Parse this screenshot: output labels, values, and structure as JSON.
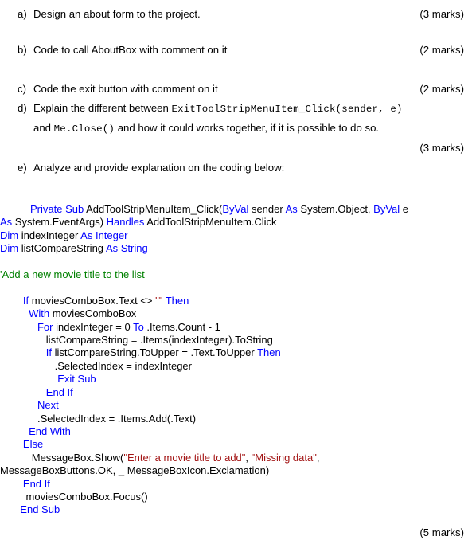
{
  "document": {
    "type": "exam-question-sheet",
    "questions": [
      {
        "marker": "a)",
        "text": "Design an about form to the project.",
        "marks": "(3 marks)"
      },
      {
        "marker": "b)",
        "text": "Code to call AboutBox with comment on it",
        "marks": "(2 marks)"
      },
      {
        "marker": "c)",
        "text": "Code the exit button with comment on it",
        "marks": "(2 marks)"
      },
      {
        "marker": "d)",
        "line1_prefix": "Explain the different between ",
        "line1_code": "ExitToolStripMenuItem_Click(sender, e)",
        "line2_prefix": "and ",
        "line2_code": "Me.Close()",
        "line2_suffix": "  and how it could works together, if it is possible to do so.",
        "marks": "(3 marks)"
      },
      {
        "marker": "e)",
        "text": "Analyze and provide explanation on the coding below:",
        "marks": "(5 marks)"
      }
    ]
  },
  "code_listing": {
    "language": "VB.NET",
    "colors": {
      "keyword": "#0000ff",
      "string": "#a31515",
      "comment": "#008000",
      "plain": "#000000"
    },
    "lines": [
      {
        "flush": false,
        "tokens": [
          {
            "t": "Private Sub ",
            "c": "kw"
          },
          {
            "t": "AddToolStripMenuItem_Click(",
            "c": "pln"
          },
          {
            "t": "ByVal ",
            "c": "kw"
          },
          {
            "t": "sender ",
            "c": "pln"
          },
          {
            "t": "As ",
            "c": "kw"
          },
          {
            "t": "System.Object, ",
            "c": "pln"
          },
          {
            "t": "ByVal ",
            "c": "kw"
          },
          {
            "t": "e",
            "c": "pln"
          }
        ]
      },
      {
        "flush": true,
        "tokens": [
          {
            "t": "As ",
            "c": "kw"
          },
          {
            "t": "System.EventArgs) ",
            "c": "pln"
          },
          {
            "t": "Handles ",
            "c": "kw"
          },
          {
            "t": "AddToolStripMenuItem.Click",
            "c": "pln"
          }
        ]
      },
      {
        "flush": true,
        "tokens": [
          {
            "t": "Dim ",
            "c": "kw"
          },
          {
            "t": "indexInteger ",
            "c": "pln"
          },
          {
            "t": "As Integer",
            "c": "kw"
          }
        ]
      },
      {
        "flush": true,
        "tokens": [
          {
            "t": "Dim ",
            "c": "kw"
          },
          {
            "t": "listCompareString ",
            "c": "pln"
          },
          {
            "t": "As String",
            "c": "kw"
          }
        ]
      },
      {
        "flush": true,
        "tokens": [
          {
            "t": "",
            "c": "pln"
          }
        ]
      },
      {
        "flush": true,
        "tokens": [
          {
            "t": "'Add a new movie title to the list",
            "c": "cmt"
          }
        ]
      },
      {
        "flush": true,
        "tokens": [
          {
            "t": "",
            "c": "pln"
          }
        ]
      },
      {
        "flush": true,
        "tokens": [
          {
            "t": "        ",
            "c": "pln"
          },
          {
            "t": "If ",
            "c": "kw"
          },
          {
            "t": "moviesComboBox.Text <> ",
            "c": "pln"
          },
          {
            "t": "\"\"",
            "c": "str"
          },
          {
            "t": " ",
            "c": "pln"
          },
          {
            "t": "Then",
            "c": "kw"
          }
        ]
      },
      {
        "flush": true,
        "tokens": [
          {
            "t": "          ",
            "c": "pln"
          },
          {
            "t": "With ",
            "c": "kw"
          },
          {
            "t": "moviesComboBox",
            "c": "pln"
          }
        ]
      },
      {
        "flush": true,
        "tokens": [
          {
            "t": "             ",
            "c": "pln"
          },
          {
            "t": "For ",
            "c": "kw"
          },
          {
            "t": "indexInteger = 0 ",
            "c": "pln"
          },
          {
            "t": "To ",
            "c": "kw"
          },
          {
            "t": ".Items.Count - 1",
            "c": "pln"
          }
        ]
      },
      {
        "flush": true,
        "tokens": [
          {
            "t": "                ",
            "c": "pln"
          },
          {
            "t": "listCompareString = .Items(indexInteger).ToString",
            "c": "pln"
          }
        ]
      },
      {
        "flush": true,
        "tokens": [
          {
            "t": "                ",
            "c": "pln"
          },
          {
            "t": "If ",
            "c": "kw"
          },
          {
            "t": "listCompareString.ToUpper = .Text.ToUpper ",
            "c": "pln"
          },
          {
            "t": "Then",
            "c": "kw"
          }
        ]
      },
      {
        "flush": true,
        "tokens": [
          {
            "t": "                   ",
            "c": "pln"
          },
          {
            "t": ".SelectedIndex = indexInteger",
            "c": "pln"
          }
        ]
      },
      {
        "flush": true,
        "tokens": [
          {
            "t": "                    ",
            "c": "pln"
          },
          {
            "t": "Exit Sub",
            "c": "kw"
          }
        ]
      },
      {
        "flush": true,
        "tokens": [
          {
            "t": "                ",
            "c": "pln"
          },
          {
            "t": "End If",
            "c": "kw"
          }
        ]
      },
      {
        "flush": true,
        "tokens": [
          {
            "t": "             ",
            "c": "pln"
          },
          {
            "t": "Next",
            "c": "kw"
          }
        ]
      },
      {
        "flush": true,
        "tokens": [
          {
            "t": "             ",
            "c": "pln"
          },
          {
            "t": ".SelectedIndex = .Items.Add(.Text)",
            "c": "pln"
          }
        ]
      },
      {
        "flush": true,
        "tokens": [
          {
            "t": "          ",
            "c": "pln"
          },
          {
            "t": "End With",
            "c": "kw"
          }
        ]
      },
      {
        "flush": true,
        "tokens": [
          {
            "t": "        ",
            "c": "pln"
          },
          {
            "t": "Else",
            "c": "kw"
          }
        ]
      },
      {
        "flush": true,
        "tokens": [
          {
            "t": "           ",
            "c": "pln"
          },
          {
            "t": "MessageBox.Show(",
            "c": "pln"
          },
          {
            "t": "\"Enter a movie title to add\"",
            "c": "str"
          },
          {
            "t": ", ",
            "c": "pln"
          },
          {
            "t": "\"Missing data\"",
            "c": "str"
          },
          {
            "t": ",",
            "c": "pln"
          }
        ]
      },
      {
        "flush": true,
        "tokens": [
          {
            "t": "MessageBoxButtons.OK, _ MessageBoxIcon.Exclamation)",
            "c": "pln"
          }
        ]
      },
      {
        "flush": true,
        "tokens": [
          {
            "t": "        ",
            "c": "pln"
          },
          {
            "t": "End If",
            "c": "kw"
          }
        ]
      },
      {
        "flush": true,
        "tokens": [
          {
            "t": "         ",
            "c": "pln"
          },
          {
            "t": "moviesComboBox.Focus()",
            "c": "pln"
          }
        ]
      },
      {
        "flush": true,
        "tokens": [
          {
            "t": "       ",
            "c": "pln"
          },
          {
            "t": "End Sub",
            "c": "kw"
          }
        ]
      }
    ]
  }
}
